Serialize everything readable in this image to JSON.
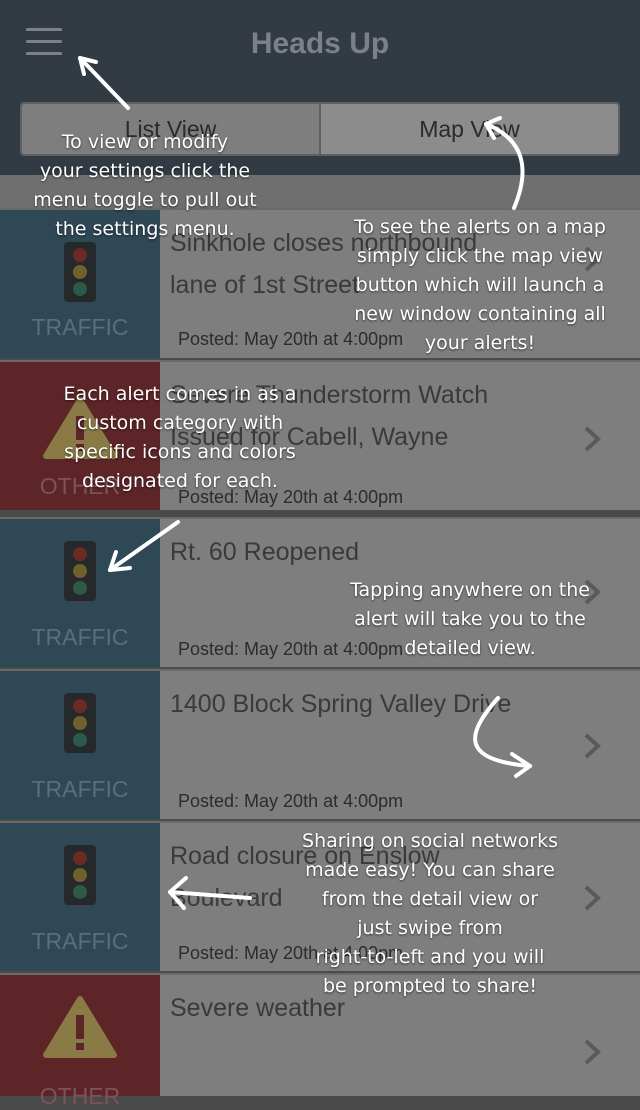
{
  "header": {
    "title": "Heads Up"
  },
  "segmented": {
    "list_label": "List View",
    "map_label": "Map View"
  },
  "alerts": [
    {
      "category": "TRAFFIC",
      "title_line1": "Sinkhole closes northbound",
      "title_line2": "lane of 1st Street",
      "posted": "Posted: May 20th at 4:00pm"
    },
    {
      "category": "OTHER",
      "title_line1": "Severe Thunderstorm Watch",
      "title_line2": "Issued for Cabell, Wayne",
      "posted": "Posted: May 20th at 4:00pm"
    },
    {
      "category": "TRAFFIC",
      "title_line1": "Rt. 60 Reopened",
      "title_line2": "",
      "posted": "Posted: May 20th at 4:00pm"
    },
    {
      "category": "TRAFFIC",
      "title_line1": "1400 Block Spring Valley Drive",
      "title_line2": "",
      "posted": "Posted: May 20th at 4:00pm"
    },
    {
      "category": "TRAFFIC",
      "title_line1": "Road closure on Enslow",
      "title_line2": "Boulevard",
      "posted": "Posted: May 20th at 4:00pm"
    },
    {
      "category": "OTHER",
      "title_line1": "Severe weather",
      "title_line2": "",
      "posted": ""
    }
  ],
  "tutorial": {
    "settings_note": [
      "To view or modify",
      "your settings click the",
      "menu toggle to pull out",
      "the settings menu."
    ],
    "map_note": [
      "To see the alerts on a map",
      "simply click the map view",
      "button which will launch a",
      "new window containing all",
      "your alerts!"
    ],
    "category_note": [
      "Each alert comes in as a",
      "custom category with",
      "specific icons and colors",
      "designated for each."
    ],
    "tap_note": [
      "Tapping anywhere on the",
      "alert will take you to the",
      "detailed view."
    ],
    "share_note": [
      "Sharing on social networks",
      "made easy! You can share",
      "from the detail view or",
      "just swipe from",
      "right-to-left and you will",
      "be prompted to share!"
    ]
  },
  "colors": {
    "header_bg": "#323b44",
    "traffic": "#2f4855",
    "other": "#5d2527",
    "row_bg": "#7e7e7e"
  }
}
